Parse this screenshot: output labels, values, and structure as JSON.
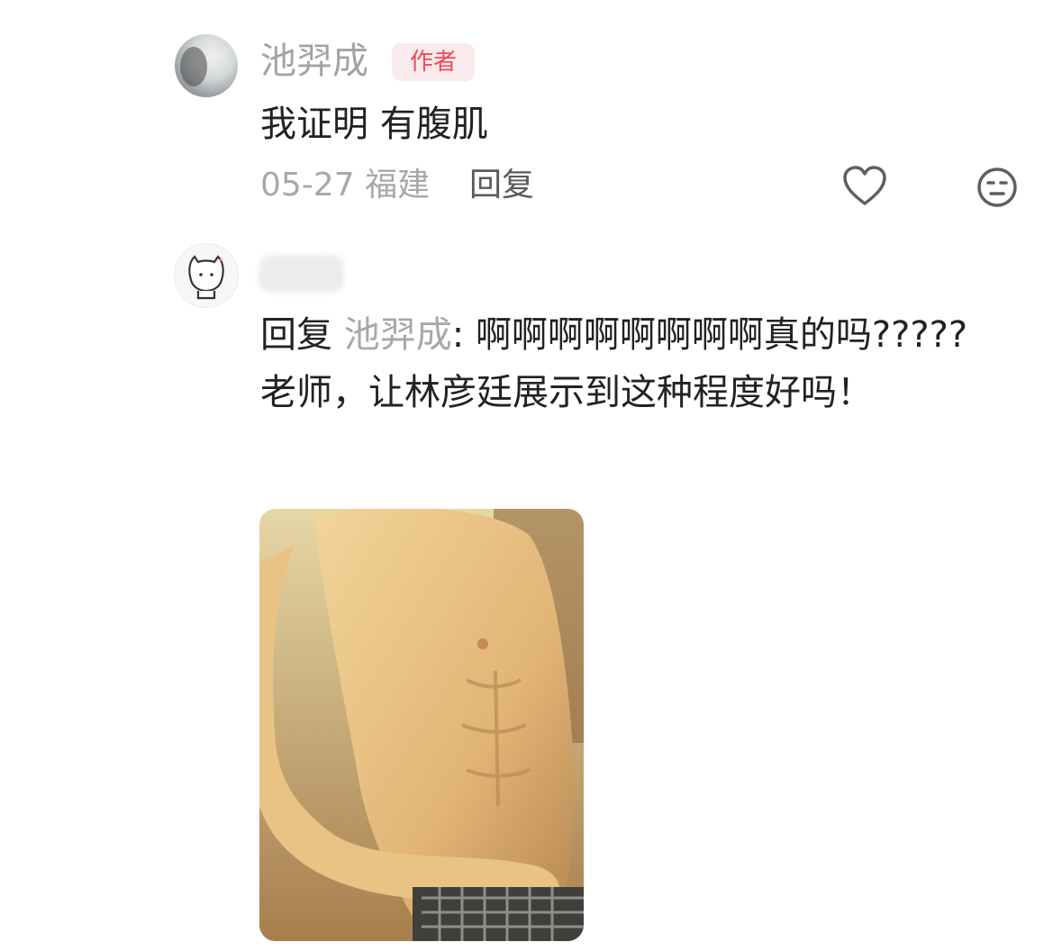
{
  "comments": [
    {
      "author": "池羿成",
      "badge": "作者",
      "text": "我证明 有腹肌",
      "date": "05-27",
      "location": "福建",
      "reply_label": "回复",
      "icons": [
        "heart-icon",
        "emoji-neutral-icon"
      ]
    },
    {
      "author_hidden": true,
      "reply_prefix": "回复",
      "mention": "池羿成",
      "text": ": 啊啊啊啊啊啊啊啊真的吗????? 老师，让林彦廷展示到这种程度好吗！",
      "has_image": true
    }
  ],
  "colors": {
    "badge_bg": "#fbeaec",
    "badge_text": "#f0475a",
    "muted_text": "#a8a8a8",
    "body_text": "#222222"
  }
}
